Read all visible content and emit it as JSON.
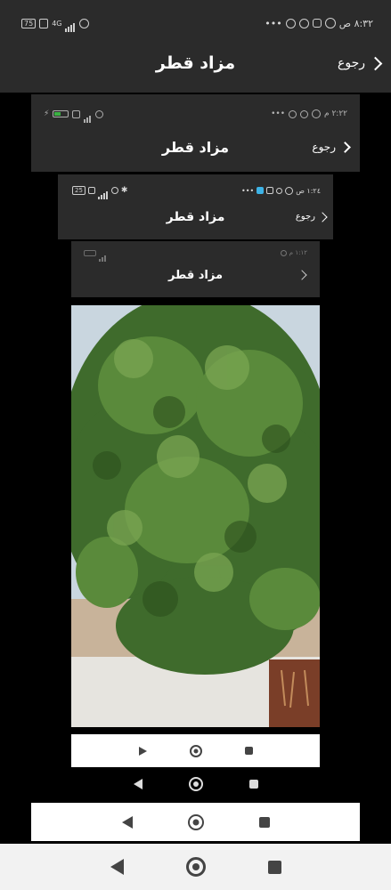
{
  "status": {
    "time": "٨:٣٢ ص",
    "battery": "75",
    "network": "4G"
  },
  "header": {
    "title": "مزاد قطر",
    "back_label": "رجوع"
  },
  "nested1": {
    "time": "٢:٢٢ م",
    "title": "مزاد قطر",
    "back_label": "رجوع"
  },
  "nested2": {
    "time": "١:٢٤ ص",
    "battery": "25",
    "title": "مزاد قطر",
    "back_label": "رجوع"
  },
  "nested3": {
    "time": "١:١٢ م",
    "title": "مزاد قطر"
  },
  "photo": {
    "subject": "tree in courtyard"
  },
  "colors": {
    "header_bg": "#2b2b2b",
    "page_bg": "#000000",
    "nav_bg": "#f2f2f2"
  }
}
